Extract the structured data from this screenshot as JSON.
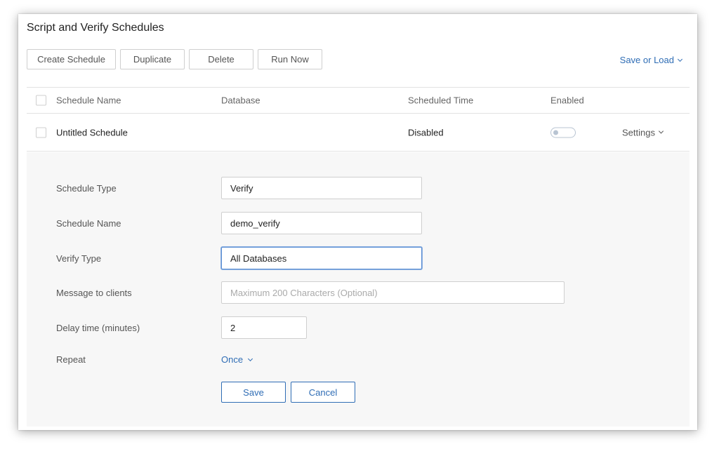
{
  "header": {
    "title": "Script and Verify Schedules"
  },
  "toolbar": {
    "create_label": "Create Schedule",
    "duplicate_label": "Duplicate",
    "delete_label": "Delete",
    "run_now_label": "Run Now",
    "save_or_load_label": "Save or Load"
  },
  "table": {
    "columns": [
      "Schedule Name",
      "Database",
      "Scheduled Time",
      "Enabled"
    ],
    "rows": [
      {
        "name": "Untitled Schedule",
        "database": "",
        "scheduled_time": "Disabled",
        "enabled": false,
        "settings_label": "Settings"
      }
    ]
  },
  "form": {
    "schedule_type": {
      "label": "Schedule Type",
      "value": "Verify"
    },
    "schedule_name": {
      "label": "Schedule Name",
      "value": "demo_verify"
    },
    "verify_type": {
      "label": "Verify Type",
      "value": "All Databases"
    },
    "message": {
      "label": "Message to clients",
      "value": "",
      "placeholder": "Maximum 200 Characters (Optional)"
    },
    "delay": {
      "label": "Delay time (minutes)",
      "value": "2"
    },
    "repeat": {
      "label": "Repeat",
      "value": "Once"
    },
    "save_label": "Save",
    "cancel_label": "Cancel"
  },
  "colors": {
    "accent": "#2f6db5",
    "border": "#cfcfcf",
    "panel_bg": "#f7f7f7"
  }
}
